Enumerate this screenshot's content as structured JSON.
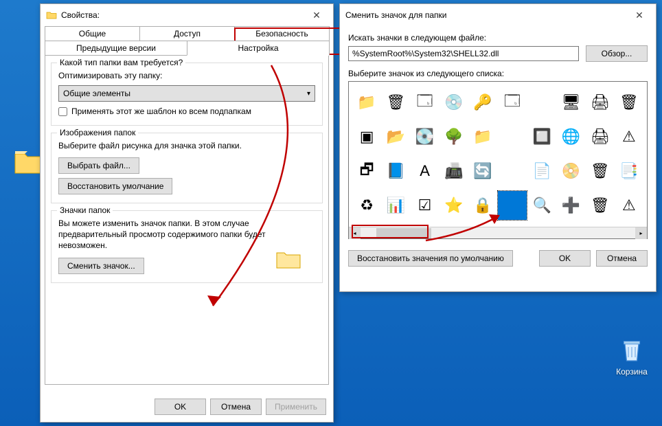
{
  "desktop": {
    "folder_label": "",
    "recycle_label": "Корзина"
  },
  "props": {
    "title": "Свойства:",
    "tabs": {
      "general": "Общие",
      "sharing": "Доступ",
      "security": "Безопасность",
      "previous": "Предыдущие версии",
      "customize": "Настройка"
    },
    "folder_type": {
      "legend": "Какой тип папки вам требуется?",
      "optimize_label": "Оптимизировать эту папку:",
      "dropdown_value": "Общие элементы",
      "apply_template_label": "Применять этот же шаблон ко всем подпапкам"
    },
    "folder_pictures": {
      "legend": "Изображения папок",
      "desc": "Выберите файл рисунка для значка этой папки.",
      "choose_btn": "Выбрать файл...",
      "restore_btn": "Восстановить умолчание"
    },
    "folder_icons": {
      "legend": "Значки папок",
      "desc": "Вы можете изменить значок папки. В этом случае предварительный просмотр содержимого папки будет невозможен.",
      "change_btn": "Сменить значок..."
    },
    "buttons": {
      "ok": "OK",
      "cancel": "Отмена",
      "apply": "Применить"
    }
  },
  "icon_dlg": {
    "title": "Сменить значок для папки",
    "search_label": "Искать значки в следующем файле:",
    "path_value": "%SystemRoot%\\System32\\SHELL32.dll",
    "browse_btn": "Обзор...",
    "select_label": "Выберите значок из следующего списка:",
    "restore_btn": "Восстановить значения по умолчанию",
    "ok_btn": "OK",
    "cancel_btn": "Отмена",
    "icons": [
      {
        "name": "folder-icon",
        "glyph": "📁"
      },
      {
        "name": "recycle-bin-icon",
        "glyph": "🗑"
      },
      {
        "name": "control-panel-icon",
        "glyph": "🗔"
      },
      {
        "name": "disc-icon",
        "glyph": "💿"
      },
      {
        "name": "key-icon",
        "glyph": "🔑"
      },
      {
        "name": "window-icon",
        "glyph": "🗔"
      },
      {
        "name": "blank-icon",
        "glyph": " "
      },
      {
        "name": "monitor-icon",
        "glyph": "🖥"
      },
      {
        "name": "printer-icon",
        "glyph": "🖨"
      },
      {
        "name": "recycle-empty-icon",
        "glyph": "🗑"
      },
      {
        "name": "shortcut-icon",
        "glyph": "▣"
      },
      {
        "name": "folder-open-icon",
        "glyph": "📂"
      },
      {
        "name": "drive-icon",
        "glyph": "💽"
      },
      {
        "name": "tree-icon",
        "glyph": "🌳"
      },
      {
        "name": "folder2-icon",
        "glyph": "📁"
      },
      {
        "name": "blank2-icon",
        "glyph": " "
      },
      {
        "name": "chip-icon",
        "glyph": "🔲"
      },
      {
        "name": "network-icon",
        "glyph": "🌐"
      },
      {
        "name": "printer2-icon",
        "glyph": "🖨"
      },
      {
        "name": "warning-folder-icon",
        "glyph": "⚠"
      },
      {
        "name": "app-icon",
        "glyph": "🗗"
      },
      {
        "name": "folder-blue-icon",
        "glyph": "📘"
      },
      {
        "name": "font-icon",
        "glyph": "A"
      },
      {
        "name": "fax-icon",
        "glyph": "📠"
      },
      {
        "name": "refresh-folder-icon",
        "glyph": "🔄"
      },
      {
        "name": "blank3-icon",
        "glyph": " "
      },
      {
        "name": "page-icon",
        "glyph": "📄"
      },
      {
        "name": "burn-icon",
        "glyph": "📀"
      },
      {
        "name": "trash-icon",
        "glyph": "🗑"
      },
      {
        "name": "pages-icon",
        "glyph": "📑"
      },
      {
        "name": "recycle2-icon",
        "glyph": "♻"
      },
      {
        "name": "chart-icon",
        "glyph": "📊"
      },
      {
        "name": "checklist-icon",
        "glyph": "☑"
      },
      {
        "name": "star-icon",
        "glyph": "⭐"
      },
      {
        "name": "lock-icon",
        "glyph": "🔒"
      },
      {
        "name": "blue-square-icon",
        "glyph": " ",
        "selected": true
      },
      {
        "name": "search2-icon",
        "glyph": "🔍"
      },
      {
        "name": "add-icon",
        "glyph": "➕"
      },
      {
        "name": "trash2-icon",
        "glyph": "🗑"
      },
      {
        "name": "warn2-icon",
        "glyph": "⚠"
      }
    ]
  }
}
